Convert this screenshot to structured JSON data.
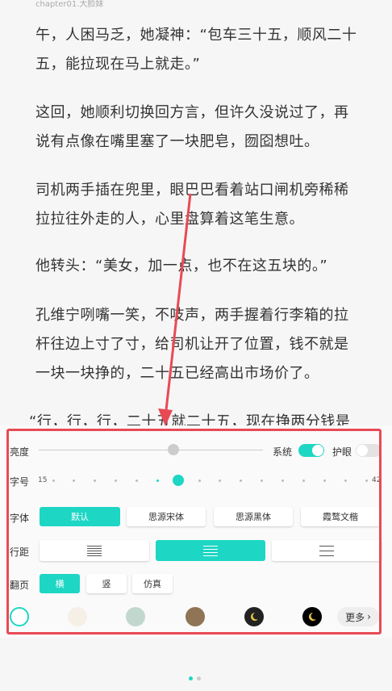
{
  "chapter": "chapter01.大脸妹",
  "paragraphs": [
    "午，人困马乏，她凝神：“包车三十五，顺风二十五，能拉现在马上就走。”",
    "这回，她顺利切换回方言，但许久没说过了，再说有点像在嘴里塞了一块肥皂，囫囵想吐。",
    "司机两手插在兜里，眼巴巴看着站口闸机旁稀稀拉拉往外走的人，心里盘算着这笔生意。",
    "他转头：“美女，加一点，也不在这五块的。”",
    "孔维宁咧嘴一笑，不吱声，两手握着行李箱的拉杆往边上寸了寸，给司机让开了位置，钱不就是一块一块挣的，二十五已经高出市场价了。",
    "“行，行，行，二十五就二十五，现在挣两分钱是"
  ],
  "settings": {
    "brightness_label": "亮度",
    "brightness_level": 0.6,
    "system_label": "系统",
    "system_on": true,
    "eye_label": "护眼",
    "eye_on": false,
    "font_size_label": "字号",
    "font_min": "15",
    "font_max": "42",
    "font_current_step": 6,
    "font_steps": 16,
    "font_label": "字体",
    "fonts": [
      "默认",
      "思源宋体",
      "思源黑体",
      "霞鹜文楷"
    ],
    "font_selected": 0,
    "spacing_label": "行距",
    "spacing_selected": 1,
    "page_turn_label": "翻页",
    "page_turns": [
      "横",
      "竖",
      "仿真"
    ],
    "page_turn_selected": 0,
    "themes": [
      {
        "name": "white",
        "color": "#ffffff"
      },
      {
        "name": "cream",
        "color": "#f5efe6"
      },
      {
        "name": "green",
        "color": "#c2d8cf"
      },
      {
        "name": "brown",
        "color": "#8f7455"
      },
      {
        "name": "dark",
        "color": "#222222"
      },
      {
        "name": "black",
        "color": "#000000"
      }
    ],
    "more_label": "更多",
    "accent": "#1ed6c4"
  }
}
